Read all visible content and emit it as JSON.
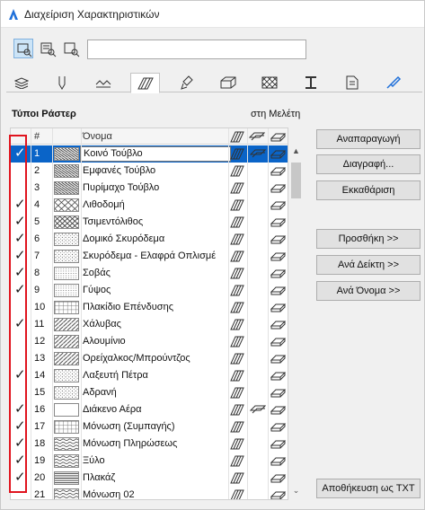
{
  "window": {
    "title": "Διαχείριση Χαρακτηριστικών"
  },
  "toolbar": {
    "modes": [
      "list-view-icon",
      "search-attributes-icon",
      "search-all-icon"
    ],
    "search_value": ""
  },
  "tabs": [
    {
      "icon": "layers-icon"
    },
    {
      "icon": "pen-icon"
    },
    {
      "icon": "line-type-icon"
    },
    {
      "icon": "fill-type-icon",
      "active": true
    },
    {
      "icon": "brush-icon"
    },
    {
      "icon": "building-material-icon"
    },
    {
      "icon": "composite-icon"
    },
    {
      "icon": "profile-icon"
    },
    {
      "icon": "zone-icon"
    },
    {
      "icon": "surface-icon"
    }
  ],
  "section": {
    "title": "Τύποι Ράστερ",
    "in_project_label": "στη Μελέτη"
  },
  "table": {
    "headers": {
      "num": "#",
      "name": "Όνομα"
    },
    "rows": [
      {
        "check": true,
        "num": "1",
        "name": "Κοινό Τούβλο",
        "pattern": "brick",
        "c2": true,
        "selected": true
      },
      {
        "check": false,
        "num": "2",
        "name": "Εμφανές Τούβλο",
        "pattern": "brick"
      },
      {
        "check": false,
        "num": "3",
        "name": "Πυρίμαχο Τούβλο",
        "pattern": "brick"
      },
      {
        "check": true,
        "num": "4",
        "name": "Λιθοδομή",
        "pattern": "stone"
      },
      {
        "check": true,
        "num": "5",
        "name": "Τσιμεντόλιθος",
        "pattern": "cross"
      },
      {
        "check": true,
        "num": "6",
        "name": "Δομικό Σκυρόδεμα",
        "pattern": "dots"
      },
      {
        "check": true,
        "num": "7",
        "name": "Σκυρόδεμα - Ελαφρά Οπλισμέ",
        "pattern": "dots"
      },
      {
        "check": true,
        "num": "8",
        "name": "Σοβάς",
        "pattern": "fine"
      },
      {
        "check": true,
        "num": "9",
        "name": "Γύψος",
        "pattern": "fine"
      },
      {
        "check": false,
        "num": "10",
        "name": "Πλακίδιο Επένδυσης",
        "pattern": "grid"
      },
      {
        "check": true,
        "num": "11",
        "name": "Χάλυβας",
        "pattern": "diag"
      },
      {
        "check": false,
        "num": "12",
        "name": "Αλουμίνιο",
        "pattern": "diag"
      },
      {
        "check": false,
        "num": "13",
        "name": "Ορείχαλκος/Μπρούντζος",
        "pattern": "diag"
      },
      {
        "check": true,
        "num": "14",
        "name": "Λαξευτή Πέτρα",
        "pattern": "dots"
      },
      {
        "check": false,
        "num": "15",
        "name": "Αδρανή",
        "pattern": "dots"
      },
      {
        "check": true,
        "num": "16",
        "name": "Διάκενο Αέρα",
        "pattern": "empty",
        "c2": true
      },
      {
        "check": true,
        "num": "17",
        "name": "Μόνωση (Συμπαγής)",
        "pattern": "grid"
      },
      {
        "check": true,
        "num": "18",
        "name": "Μόνωση Πληρώσεως",
        "pattern": "wave"
      },
      {
        "check": true,
        "num": "19",
        "name": "Ξύλο",
        "pattern": "wave"
      },
      {
        "check": true,
        "num": "20",
        "name": "Πλακάζ",
        "pattern": "lines"
      },
      {
        "check": false,
        "num": "21",
        "name": "Μόνωση 02",
        "pattern": "wave"
      }
    ]
  },
  "buttons": {
    "duplicate": "Αναπαραγωγή",
    "delete": "Διαγραφή...",
    "clear": "Εκκαθάριση",
    "add": "Προσθήκη >>",
    "by_index": "Ανά Δείκτη >>",
    "by_name": "Ανά Όνομα >>",
    "save_txt": "Αποθήκευση ως TXT"
  },
  "colors": {
    "selection": "#0a64c8",
    "highlight_box": "#e0141e",
    "accent": "#1e6fd9"
  }
}
